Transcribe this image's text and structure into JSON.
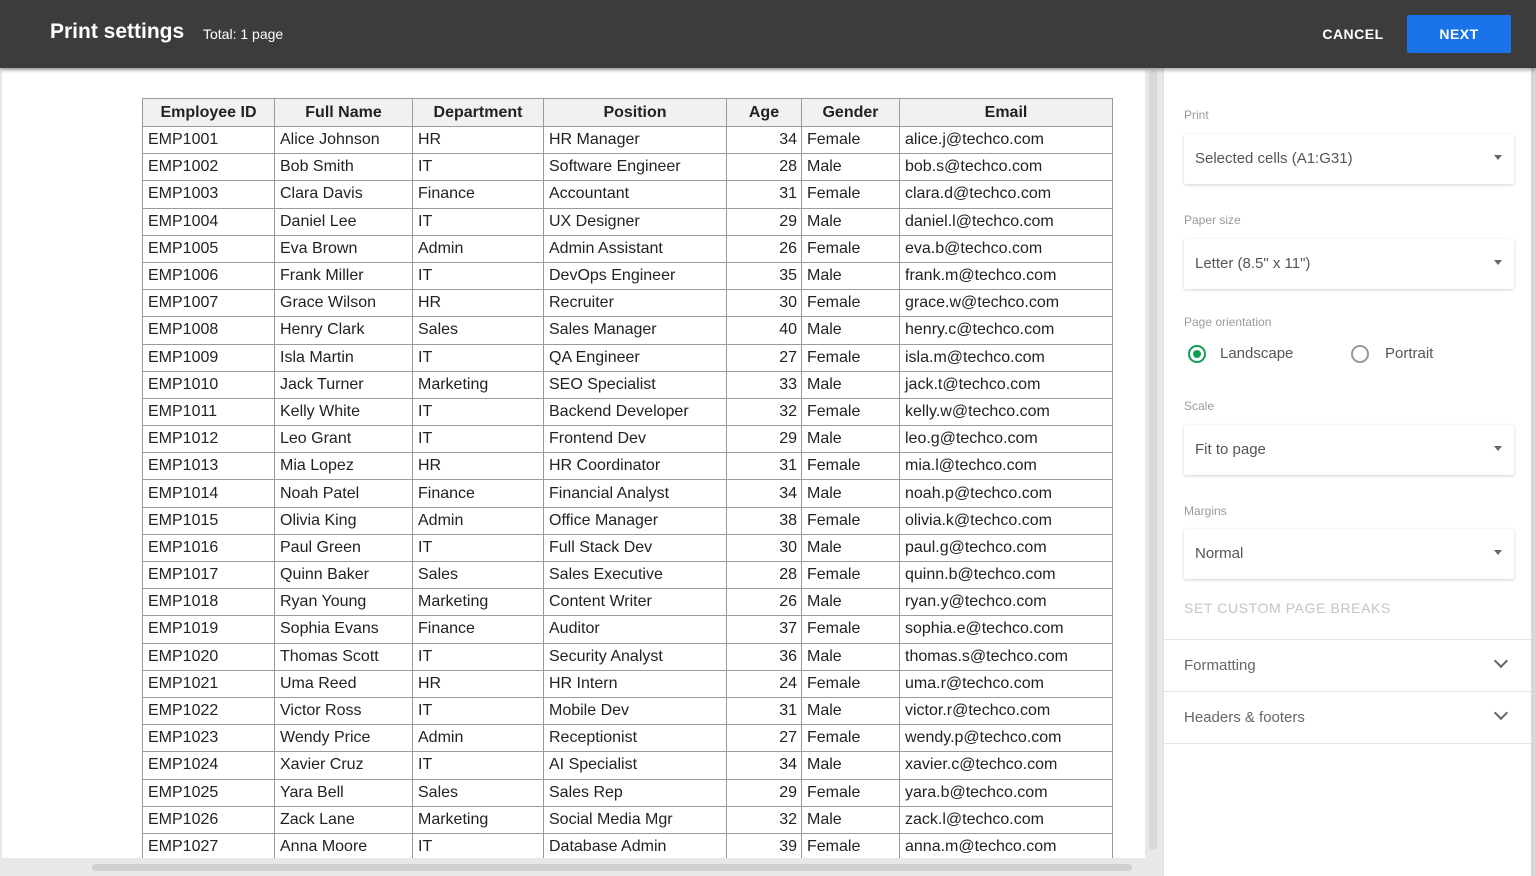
{
  "header": {
    "title": "Print settings",
    "subtitle": "Total: 1 page",
    "cancel_label": "CANCEL",
    "next_label": "NEXT"
  },
  "table": {
    "columns": [
      "Employee ID",
      "Full Name",
      "Department",
      "Position",
      "Age",
      "Gender",
      "Email"
    ],
    "rows": [
      [
        "EMP1001",
        "Alice Johnson",
        "HR",
        "HR Manager",
        "34",
        "Female",
        "alice.j@techco.com"
      ],
      [
        "EMP1002",
        "Bob Smith",
        "IT",
        "Software Engineer",
        "28",
        "Male",
        "bob.s@techco.com"
      ],
      [
        "EMP1003",
        "Clara Davis",
        "Finance",
        "Accountant",
        "31",
        "Female",
        "clara.d@techco.com"
      ],
      [
        "EMP1004",
        "Daniel Lee",
        "IT",
        "UX Designer",
        "29",
        "Male",
        "daniel.l@techco.com"
      ],
      [
        "EMP1005",
        "Eva Brown",
        "Admin",
        "Admin Assistant",
        "26",
        "Female",
        "eva.b@techco.com"
      ],
      [
        "EMP1006",
        "Frank Miller",
        "IT",
        "DevOps Engineer",
        "35",
        "Male",
        "frank.m@techco.com"
      ],
      [
        "EMP1007",
        "Grace Wilson",
        "HR",
        "Recruiter",
        "30",
        "Female",
        "grace.w@techco.com"
      ],
      [
        "EMP1008",
        "Henry Clark",
        "Sales",
        "Sales Manager",
        "40",
        "Male",
        "henry.c@techco.com"
      ],
      [
        "EMP1009",
        "Isla Martin",
        "IT",
        "QA Engineer",
        "27",
        "Female",
        "isla.m@techco.com"
      ],
      [
        "EMP1010",
        "Jack Turner",
        "Marketing",
        "SEO Specialist",
        "33",
        "Male",
        "jack.t@techco.com"
      ],
      [
        "EMP1011",
        "Kelly White",
        "IT",
        "Backend Developer",
        "32",
        "Female",
        "kelly.w@techco.com"
      ],
      [
        "EMP1012",
        "Leo Grant",
        "IT",
        "Frontend Dev",
        "29",
        "Male",
        "leo.g@techco.com"
      ],
      [
        "EMP1013",
        "Mia Lopez",
        "HR",
        "HR Coordinator",
        "31",
        "Female",
        "mia.l@techco.com"
      ],
      [
        "EMP1014",
        "Noah Patel",
        "Finance",
        "Financial Analyst",
        "34",
        "Male",
        "noah.p@techco.com"
      ],
      [
        "EMP1015",
        "Olivia King",
        "Admin",
        "Office Manager",
        "38",
        "Female",
        "olivia.k@techco.com"
      ],
      [
        "EMP1016",
        "Paul Green",
        "IT",
        "Full Stack Dev",
        "30",
        "Male",
        "paul.g@techco.com"
      ],
      [
        "EMP1017",
        "Quinn Baker",
        "Sales",
        "Sales Executive",
        "28",
        "Female",
        "quinn.b@techco.com"
      ],
      [
        "EMP1018",
        "Ryan Young",
        "Marketing",
        "Content Writer",
        "26",
        "Male",
        "ryan.y@techco.com"
      ],
      [
        "EMP1019",
        "Sophia Evans",
        "Finance",
        "Auditor",
        "37",
        "Female",
        "sophia.e@techco.com"
      ],
      [
        "EMP1020",
        "Thomas Scott",
        "IT",
        "Security Analyst",
        "36",
        "Male",
        "thomas.s@techco.com"
      ],
      [
        "EMP1021",
        "Uma Reed",
        "HR",
        "HR Intern",
        "24",
        "Female",
        "uma.r@techco.com"
      ],
      [
        "EMP1022",
        "Victor Ross",
        "IT",
        "Mobile Dev",
        "31",
        "Male",
        "victor.r@techco.com"
      ],
      [
        "EMP1023",
        "Wendy Price",
        "Admin",
        "Receptionist",
        "27",
        "Female",
        "wendy.p@techco.com"
      ],
      [
        "EMP1024",
        "Xavier Cruz",
        "IT",
        "AI Specialist",
        "34",
        "Male",
        "xavier.c@techco.com"
      ],
      [
        "EMP1025",
        "Yara Bell",
        "Sales",
        "Sales Rep",
        "29",
        "Female",
        "yara.b@techco.com"
      ],
      [
        "EMP1026",
        "Zack Lane",
        "Marketing",
        "Social Media Mgr",
        "32",
        "Male",
        "zack.l@techco.com"
      ],
      [
        "EMP1027",
        "Anna Moore",
        "IT",
        "Database Admin",
        "39",
        "Female",
        "anna.m@techco.com"
      ]
    ]
  },
  "panel": {
    "print_label": "Print",
    "print_value": "Selected cells (A1:G31)",
    "paper_size_label": "Paper size",
    "paper_size_value": "Letter (8.5\" x 11\")",
    "orientation_label": "Page orientation",
    "landscape_label": "Landscape",
    "portrait_label": "Portrait",
    "orientation_selected": "Landscape",
    "scale_label": "Scale",
    "scale_value": "Fit to page",
    "margins_label": "Margins",
    "margins_value": "Normal",
    "custom_breaks_label": "SET CUSTOM PAGE BREAKS",
    "formatting_label": "Formatting",
    "headers_footers_label": "Headers & footers"
  },
  "colors": {
    "topbar": "#3c3c3c",
    "accent": "#1a73e8",
    "radio_selected": "#0f9d58"
  },
  "icons": [
    "chevron-down-icon",
    "dropdown-caret-icon",
    "radio-icon"
  ]
}
